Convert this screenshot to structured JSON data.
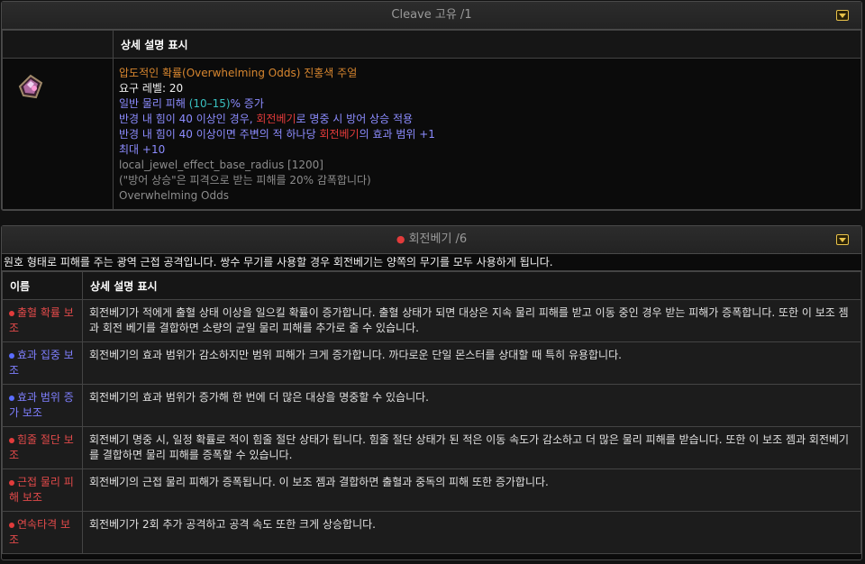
{
  "unique": {
    "header": "Cleave 고유 /1",
    "col_header": "상세 설명 표시",
    "item_name": "압도적인 확률(Overwhelming Odds) 진홍색 주얼",
    "req_label": "요구 레벨: 20",
    "mod1_pre": "일반 물리 피해 ",
    "mod1_range": "(10–15)",
    "mod1_post": "% 증가",
    "mod2_pre": "반경 내 힘이 40 이상인 경우, ",
    "mod2_skill": "회전베기",
    "mod2_post": "로 명중 시 방어 상승 적용",
    "mod3_pre": "반경 내 힘이 40 이상이면 주변의 적 하나당 ",
    "mod3_skill": "회전베기",
    "mod3_post": "의 효과 범위 +1",
    "mod4": "최대 +10",
    "raw1": "local_jewel_effect_base_radius [1200]",
    "raw2": "(\"방어 상승\"은 피격으로 받는 피해를 20% 감폭합니다)",
    "raw3": "Overwhelming Odds"
  },
  "skill": {
    "header": "회전베기 /6",
    "intro": "원호 형태로 피해를 주는 광역 근접 공격입니다. 쌍수 무기를 사용할 경우 회전베기는 양쪽의 무기를 모두 사용하게 됩니다.",
    "col_name": "이름",
    "col_desc": "상세 설명 표시",
    "supports": [
      {
        "name": "출혈 확률 보조",
        "color": "red",
        "desc": "회전베기가 적에게 출혈 상태 이상을 일으킬 확률이 증가합니다. 출혈 상태가 되면 대상은 지속 물리 피해를 받고 이동 중인 경우 받는 피해가 증폭합니다. 또한 이 보조 젬과 회전 베기를 결합하면 소량의 균일 물리 피해를 추가로 줄 수 있습니다."
      },
      {
        "name": "효과 집중 보조",
        "color": "blue",
        "desc": "회전베기의 효과 범위가 감소하지만 범위 피해가 크게 증가합니다. 까다로운 단일 몬스터를 상대할 때 특히 유용합니다."
      },
      {
        "name": "효과 범위 증가 보조",
        "color": "blue",
        "desc": "회전베기의 효과 범위가 증가해 한 번에 더 많은 대상을 명중할 수 있습니다."
      },
      {
        "name": "힘줄 절단 보조",
        "color": "red",
        "desc": "회전베기 명중 시, 일정 확률로 적이 힘줄 절단 상태가 됩니다. 힘줄 절단 상태가 된 적은 이동 속도가 감소하고 더 많은 물리 피해를 받습니다. 또한 이 보조 젬과 회전베기를 결합하면 물리 피해를 증폭할 수 있습니다."
      },
      {
        "name": "근접 물리 피해 보조",
        "color": "red",
        "desc": "회전베기의 근접 물리 피해가 증폭됩니다. 이 보조 젬과 결합하면 출혈과 중독의 피해 또한 증가합니다."
      },
      {
        "name": "연속타격 보조",
        "color": "red",
        "desc": "회전베기가 2회 추가 공격하고 공격 속도 또한 크게 상승합니다."
      }
    ]
  },
  "icons": {
    "toggle": "chevron-down-icon",
    "jewel": "crimson-jewel-icon",
    "skill": "red-gem-icon"
  },
  "colors": {
    "accent": "#e8c24a",
    "item_name": "#d7862f",
    "mod": "#8c8cff",
    "range": "#39c0c0",
    "skill_ref": "#e23b3b"
  }
}
